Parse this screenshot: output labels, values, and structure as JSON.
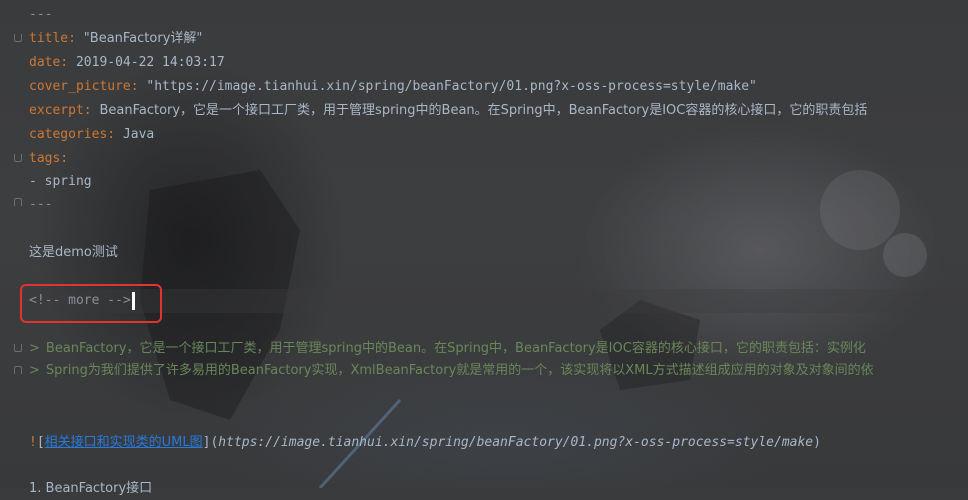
{
  "editor": {
    "lines": {
      "fm_open": "---",
      "title_key": "title: ",
      "title_val": "\"BeanFactory详解\"",
      "date_key": "date: ",
      "date_val": "2019-04-22 14:03:17",
      "cover_key": "cover_picture: ",
      "cover_val": "\"https://image.tianhui.xin/spring/beanFactory/01.png?x-oss-process=style/make\"",
      "excerpt_key": "excerpt: ",
      "excerpt_val": "BeanFactory，它是一个接口工厂类，用于管理spring中的Bean。在Spring中，BeanFactory是IOC容器的核心接口，它的职责包括",
      "categories_key": "categories: ",
      "categories_val": "Java",
      "tags_key": "tags:",
      "tag_item": "- spring",
      "fm_close": "---",
      "demo_text": "这是demo测试",
      "more_comment": "<!-- more -->",
      "quote1_mark": ">",
      "quote1_text": "BeanFactory，它是一个接口工厂类，用于管理spring中的Bean。在Spring中，BeanFactory是IOC容器的核心接口，它的职责包括：实例化",
      "quote2_mark": ">",
      "quote2_text": "Spring为我们提供了许多易用的BeanFactory实现，XmlBeanFactory就是常用的一个，该实现将以XML方式描述组成应用的对象及对象间的依",
      "img_bang": "!",
      "img_open": "[",
      "img_alt": "相关接口和实现类的UML图",
      "img_close": "]",
      "img_url_open": "(",
      "img_url": "https://image.tianhui.xin/spring/beanFactory/01.png?x-oss-process=style/make",
      "img_url_close": ")",
      "last_line": "1. BeanFactory接口"
    }
  },
  "colors": {
    "highlight_box": "#e1342f",
    "keyword": "#cc7832",
    "quote": "#6a8759",
    "link": "#287bde",
    "text": "#a9b7c6"
  },
  "icons": {
    "fold_markers": "fold-icon"
  }
}
